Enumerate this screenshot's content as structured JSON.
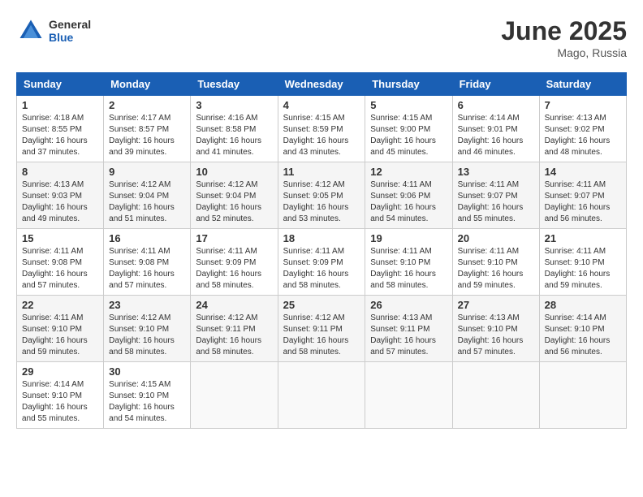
{
  "header": {
    "logo_general": "General",
    "logo_blue": "Blue",
    "month_year": "June 2025",
    "location": "Mago, Russia"
  },
  "days_of_week": [
    "Sunday",
    "Monday",
    "Tuesday",
    "Wednesday",
    "Thursday",
    "Friday",
    "Saturday"
  ],
  "weeks": [
    [
      {
        "day": "1",
        "info": "Sunrise: 4:18 AM\nSunset: 8:55 PM\nDaylight: 16 hours\nand 37 minutes."
      },
      {
        "day": "2",
        "info": "Sunrise: 4:17 AM\nSunset: 8:57 PM\nDaylight: 16 hours\nand 39 minutes."
      },
      {
        "day": "3",
        "info": "Sunrise: 4:16 AM\nSunset: 8:58 PM\nDaylight: 16 hours\nand 41 minutes."
      },
      {
        "day": "4",
        "info": "Sunrise: 4:15 AM\nSunset: 8:59 PM\nDaylight: 16 hours\nand 43 minutes."
      },
      {
        "day": "5",
        "info": "Sunrise: 4:15 AM\nSunset: 9:00 PM\nDaylight: 16 hours\nand 45 minutes."
      },
      {
        "day": "6",
        "info": "Sunrise: 4:14 AM\nSunset: 9:01 PM\nDaylight: 16 hours\nand 46 minutes."
      },
      {
        "day": "7",
        "info": "Sunrise: 4:13 AM\nSunset: 9:02 PM\nDaylight: 16 hours\nand 48 minutes."
      }
    ],
    [
      {
        "day": "8",
        "info": "Sunrise: 4:13 AM\nSunset: 9:03 PM\nDaylight: 16 hours\nand 49 minutes."
      },
      {
        "day": "9",
        "info": "Sunrise: 4:12 AM\nSunset: 9:04 PM\nDaylight: 16 hours\nand 51 minutes."
      },
      {
        "day": "10",
        "info": "Sunrise: 4:12 AM\nSunset: 9:04 PM\nDaylight: 16 hours\nand 52 minutes."
      },
      {
        "day": "11",
        "info": "Sunrise: 4:12 AM\nSunset: 9:05 PM\nDaylight: 16 hours\nand 53 minutes."
      },
      {
        "day": "12",
        "info": "Sunrise: 4:11 AM\nSunset: 9:06 PM\nDaylight: 16 hours\nand 54 minutes."
      },
      {
        "day": "13",
        "info": "Sunrise: 4:11 AM\nSunset: 9:07 PM\nDaylight: 16 hours\nand 55 minutes."
      },
      {
        "day": "14",
        "info": "Sunrise: 4:11 AM\nSunset: 9:07 PM\nDaylight: 16 hours\nand 56 minutes."
      }
    ],
    [
      {
        "day": "15",
        "info": "Sunrise: 4:11 AM\nSunset: 9:08 PM\nDaylight: 16 hours\nand 57 minutes."
      },
      {
        "day": "16",
        "info": "Sunrise: 4:11 AM\nSunset: 9:08 PM\nDaylight: 16 hours\nand 57 minutes."
      },
      {
        "day": "17",
        "info": "Sunrise: 4:11 AM\nSunset: 9:09 PM\nDaylight: 16 hours\nand 58 minutes."
      },
      {
        "day": "18",
        "info": "Sunrise: 4:11 AM\nSunset: 9:09 PM\nDaylight: 16 hours\nand 58 minutes."
      },
      {
        "day": "19",
        "info": "Sunrise: 4:11 AM\nSunset: 9:10 PM\nDaylight: 16 hours\nand 58 minutes."
      },
      {
        "day": "20",
        "info": "Sunrise: 4:11 AM\nSunset: 9:10 PM\nDaylight: 16 hours\nand 59 minutes."
      },
      {
        "day": "21",
        "info": "Sunrise: 4:11 AM\nSunset: 9:10 PM\nDaylight: 16 hours\nand 59 minutes."
      }
    ],
    [
      {
        "day": "22",
        "info": "Sunrise: 4:11 AM\nSunset: 9:10 PM\nDaylight: 16 hours\nand 59 minutes."
      },
      {
        "day": "23",
        "info": "Sunrise: 4:12 AM\nSunset: 9:10 PM\nDaylight: 16 hours\nand 58 minutes."
      },
      {
        "day": "24",
        "info": "Sunrise: 4:12 AM\nSunset: 9:11 PM\nDaylight: 16 hours\nand 58 minutes."
      },
      {
        "day": "25",
        "info": "Sunrise: 4:12 AM\nSunset: 9:11 PM\nDaylight: 16 hours\nand 58 minutes."
      },
      {
        "day": "26",
        "info": "Sunrise: 4:13 AM\nSunset: 9:11 PM\nDaylight: 16 hours\nand 57 minutes."
      },
      {
        "day": "27",
        "info": "Sunrise: 4:13 AM\nSunset: 9:10 PM\nDaylight: 16 hours\nand 57 minutes."
      },
      {
        "day": "28",
        "info": "Sunrise: 4:14 AM\nSunset: 9:10 PM\nDaylight: 16 hours\nand 56 minutes."
      }
    ],
    [
      {
        "day": "29",
        "info": "Sunrise: 4:14 AM\nSunset: 9:10 PM\nDaylight: 16 hours\nand 55 minutes."
      },
      {
        "day": "30",
        "info": "Sunrise: 4:15 AM\nSunset: 9:10 PM\nDaylight: 16 hours\nand 54 minutes."
      },
      {
        "day": "",
        "info": ""
      },
      {
        "day": "",
        "info": ""
      },
      {
        "day": "",
        "info": ""
      },
      {
        "day": "",
        "info": ""
      },
      {
        "day": "",
        "info": ""
      }
    ]
  ]
}
